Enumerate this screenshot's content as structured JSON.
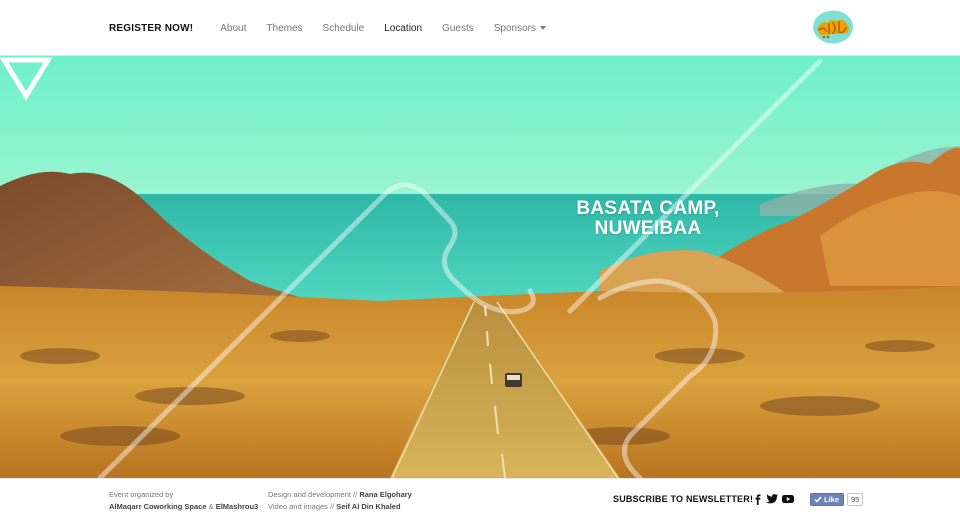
{
  "nav": {
    "register": "REGISTER NOW!",
    "about": "About",
    "themes": "Themes",
    "schedule": "Schedule",
    "location": "Location",
    "guests": "Guests",
    "sponsors": "Sponsors"
  },
  "hero": {
    "title_line1": "BASATA CAMP,",
    "title_line2": "NUWEIBAA"
  },
  "footer": {
    "organized_label": "Event organized by",
    "organizer1": "AlMaqarr Coworking Space",
    "organizer_sep": " & ",
    "organizer2": "ElMashrou3",
    "design_label": "Design and development // ",
    "designer": "Rana Elgohary",
    "video_label": "Video and images // ",
    "photographer": "Seif Al Din Khaled",
    "subscribe": "SUBSCRIBE TO NEWSLETTER!",
    "like_label": "Like",
    "like_count": "95"
  },
  "icons": {
    "logo": "arabic-logo-icon",
    "down": "down-triangle-icon",
    "facebook": "facebook-icon",
    "twitter": "twitter-icon",
    "youtube": "youtube-icon"
  },
  "colors": {
    "sky": "#7ef2c4",
    "sea": "#2fd0b0",
    "sand": "#d9a13a",
    "accent_fb": "#6d84b4"
  }
}
